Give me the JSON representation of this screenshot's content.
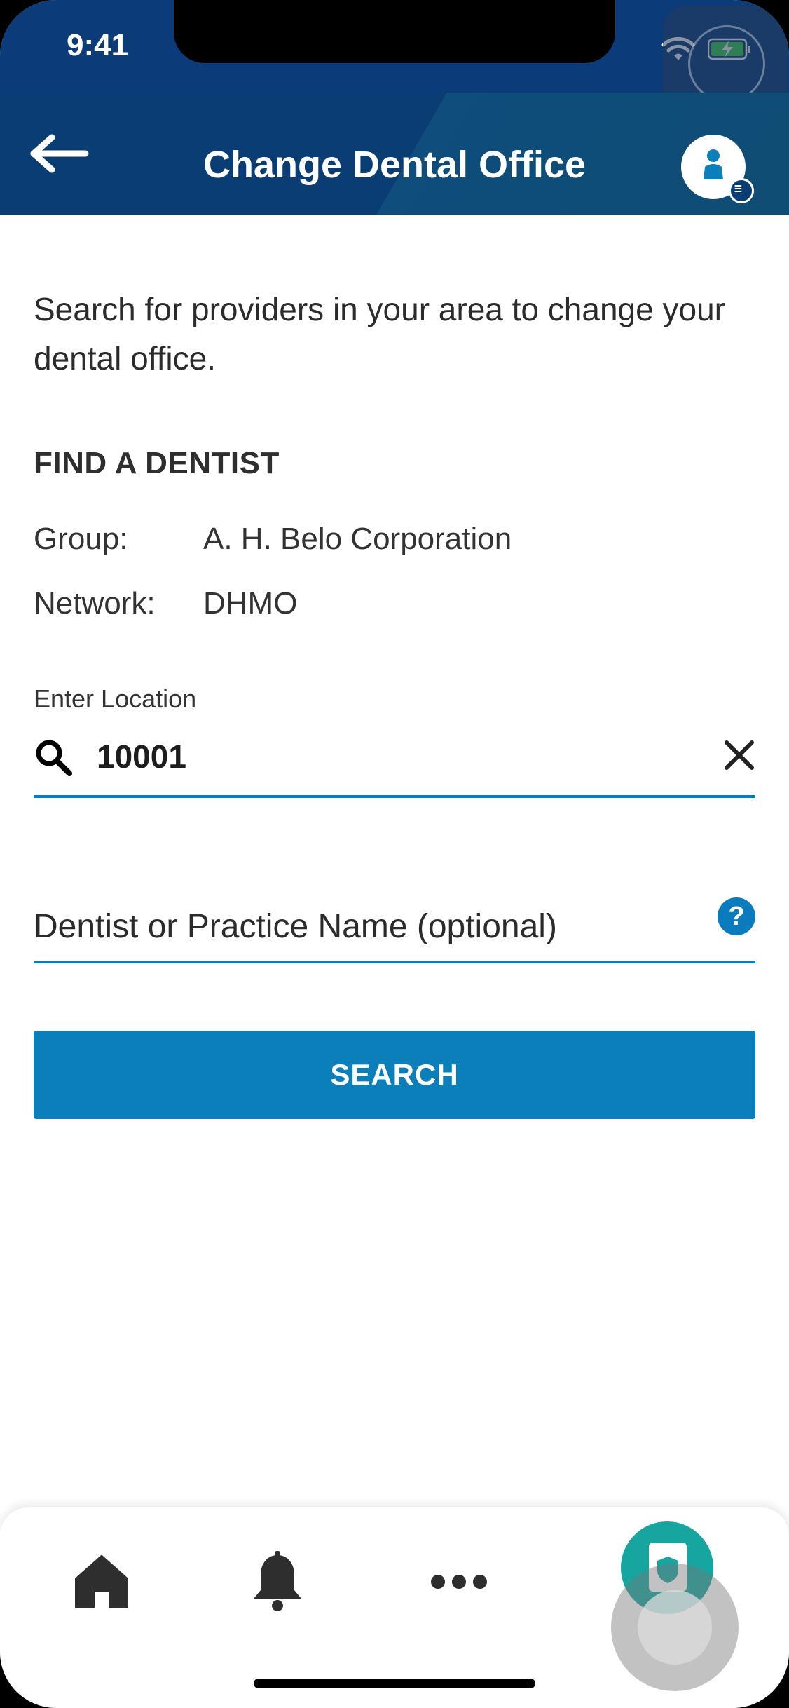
{
  "status_bar": {
    "time": "9:41",
    "wifi_icon": "wifi-icon",
    "battery_icon": "battery-charging-icon"
  },
  "header": {
    "title": "Change Dental Office",
    "back_icon": "arrow-left-icon",
    "profile_icon": "profile-icon"
  },
  "intro": {
    "text": "Search for providers in your area to change your dental office."
  },
  "find_dentist": {
    "title": "FIND A DENTIST",
    "group_label": "Group:",
    "group_value": "A. H. Belo Corporation",
    "network_label": "Network:",
    "network_value": "DHMO"
  },
  "location": {
    "label": "Enter Location",
    "value": "10001",
    "search_icon": "search-icon",
    "clear_icon": "close-icon"
  },
  "name_field": {
    "placeholder": "Dentist or Practice Name (optional)",
    "help_icon": "?"
  },
  "search_button": {
    "label": "SEARCH"
  },
  "tab_bar": {
    "items": [
      {
        "icon": "home-icon"
      },
      {
        "icon": "bell-icon"
      },
      {
        "icon": "more-icon"
      },
      {
        "icon": "dental-card-icon",
        "active": true
      }
    ]
  },
  "colors": {
    "header_bg": "#0a3d73",
    "accent": "#0a7fb9",
    "active_tab": "#17a5a0"
  }
}
